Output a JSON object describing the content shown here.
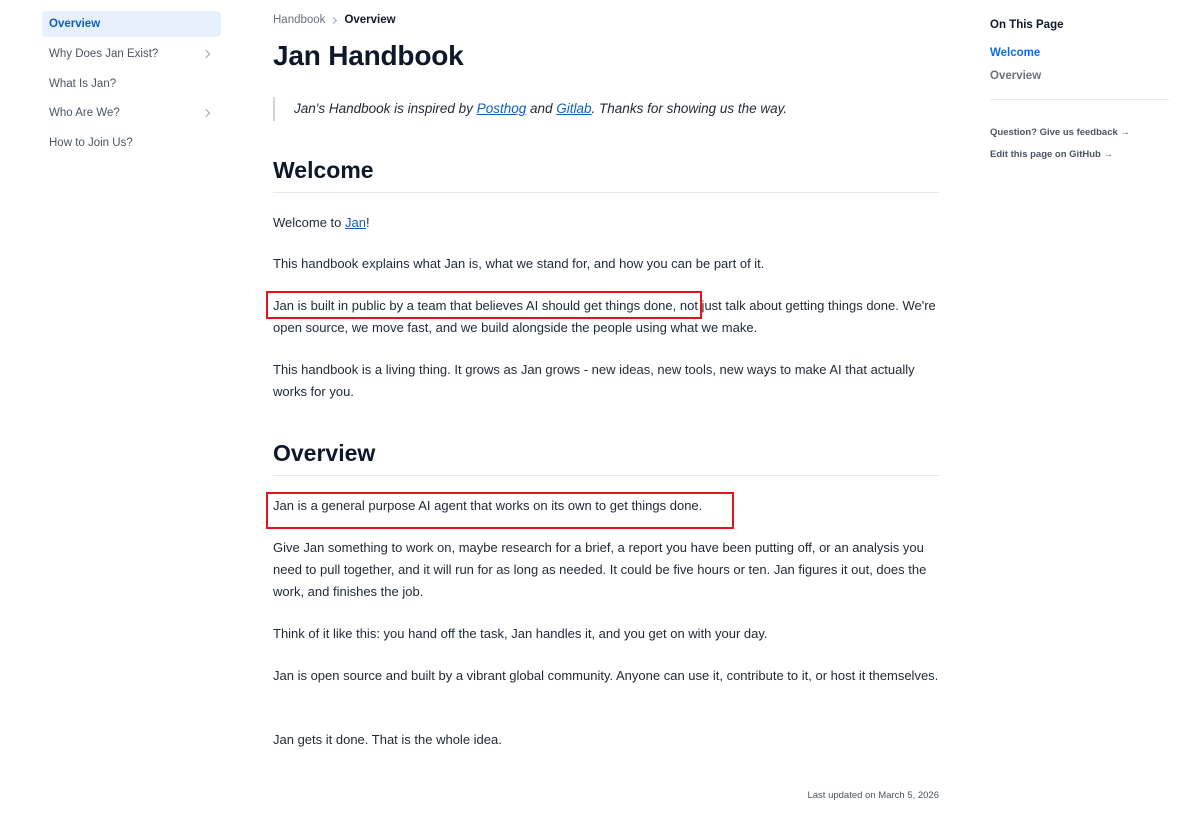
{
  "sidebar": {
    "items": [
      {
        "label": "Overview"
      },
      {
        "label": "Why Does Jan Exist?"
      },
      {
        "label": "What Is Jan?"
      },
      {
        "label": "Who Are We?"
      },
      {
        "label": "How to Join Us?"
      }
    ]
  },
  "breadcrumb": {
    "parent": "Handbook",
    "current": "Overview"
  },
  "main": {
    "title": "Jan Handbook",
    "quote": {
      "prefix": "Jan's Handbook is inspired by ",
      "link1": "Posthog",
      "middle": " and ",
      "link2": "Gitlab",
      "suffix": ". Thanks for showing us the way."
    },
    "welcome": {
      "heading": "Welcome",
      "p1_prefix": "Welcome to ",
      "p1_link": "Jan",
      "p1_suffix": "!",
      "p2": "This handbook explains what Jan is, what we stand for, and how you can be part of it.",
      "p3": "Jan is built in public by a team that believes AI should get things done, not just talk about getting things done. We're open source, we move fast, and we build alongside the people using what we make.",
      "p4": "This handbook is a living thing. It grows as Jan grows - new ideas, new tools, new ways to make AI that actually works for you."
    },
    "overview": {
      "heading": "Overview",
      "p1": "Jan is a general purpose AI agent that works on its own to get things done.",
      "p2": "Give Jan something to work on, maybe research for a brief, a report you have been putting off, or an analysis you need to pull together, and it will run for as long as needed. It could be five hours or ten. Jan figures it out, does the work, and finishes the job.",
      "p3": "Think of it like this: you hand off the task, Jan handles it, and you get on with your day.",
      "p4": "Jan is open source and built by a vibrant global community. Anyone can use it, contribute to it, or host it themselves.",
      "p5": "Jan gets it done. That is the whole idea."
    },
    "last_updated": "Last updated on March 5, 2026"
  },
  "toc": {
    "title": "On This Page",
    "items": [
      {
        "label": "Welcome"
      },
      {
        "label": "Overview"
      }
    ],
    "feedback": "Question? Give us feedback →",
    "edit": "Edit this page on GitHub →"
  },
  "colors": {
    "accent": "#0c5fb8",
    "active_bg": "#e7f1fd",
    "highlight": "#e8101a"
  }
}
